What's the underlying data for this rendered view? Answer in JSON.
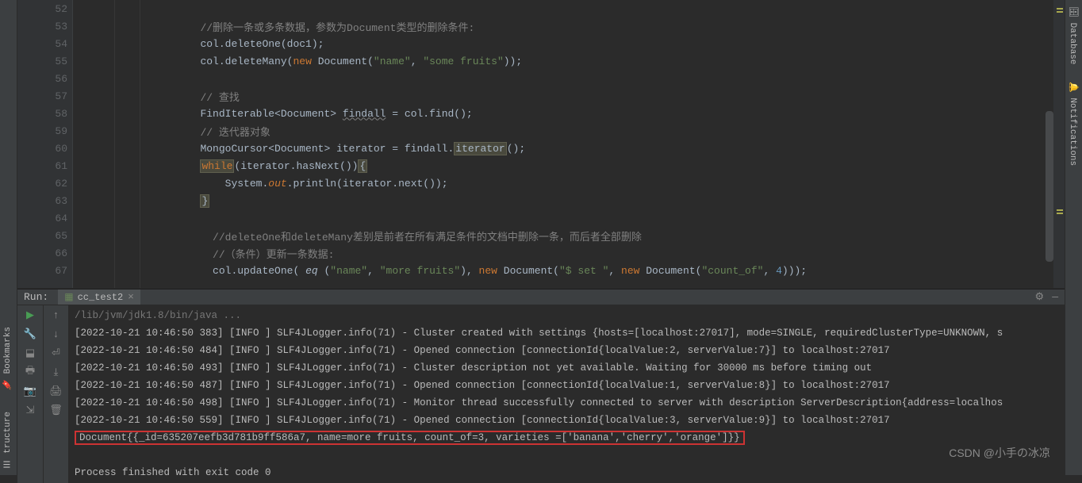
{
  "editor": {
    "lines": [
      {
        "num": 52,
        "segments": []
      },
      {
        "num": 53,
        "segments": [
          {
            "cls": "c-comment",
            "text": "//删除一条或多条数据，参数为Document类型的删除条件:"
          }
        ]
      },
      {
        "num": 54,
        "segments": [
          {
            "cls": "c-plain",
            "text": "col.deleteOne(doc1);"
          }
        ]
      },
      {
        "num": 55,
        "segments": [
          {
            "cls": "c-plain",
            "text": "col.deleteMany("
          },
          {
            "cls": "c-keyword",
            "text": "new "
          },
          {
            "cls": "c-plain",
            "text": "Document("
          },
          {
            "cls": "c-string",
            "text": "\"name\""
          },
          {
            "cls": "c-plain",
            "text": ", "
          },
          {
            "cls": "c-string",
            "text": "\"some fruits\""
          },
          {
            "cls": "c-plain",
            "text": "));"
          }
        ]
      },
      {
        "num": 56,
        "segments": []
      },
      {
        "num": 57,
        "segments": [
          {
            "cls": "c-comment",
            "text": "// 查找"
          }
        ]
      },
      {
        "num": 58,
        "segments": [
          {
            "cls": "c-plain",
            "text": "FindIterable<Document> "
          },
          {
            "cls": "underline-wave",
            "text": "findall"
          },
          {
            "cls": "c-plain",
            "text": " = col.find();"
          }
        ]
      },
      {
        "num": 59,
        "segments": [
          {
            "cls": "c-comment",
            "text": "// 迭代器对象"
          }
        ]
      },
      {
        "num": 60,
        "segments": [
          {
            "cls": "c-plain",
            "text": "MongoCursor<Document> iterator = findall."
          },
          {
            "cls": "hl-box",
            "text": "iterator"
          },
          {
            "cls": "c-plain",
            "text": "();"
          }
        ]
      },
      {
        "num": 61,
        "segments": [
          {
            "cls": "hl-box c-keyword",
            "text": "while"
          },
          {
            "cls": "c-plain",
            "text": "(iterator.hasNext())"
          },
          {
            "cls": "hl-box",
            "text": "{"
          }
        ]
      },
      {
        "num": 62,
        "segments": [
          {
            "cls": "c-plain",
            "text": "    System."
          },
          {
            "cls": "c-field",
            "text": "out"
          },
          {
            "cls": "c-plain",
            "text": ".println(iterator.next());"
          }
        ]
      },
      {
        "num": 63,
        "segments": [
          {
            "cls": "hl-box",
            "text": "}"
          }
        ]
      },
      {
        "num": 64,
        "segments": []
      },
      {
        "num": 65,
        "segments": [
          {
            "cls": "c-comment",
            "text": "//deleteOne和deleteMany差别是前者在所有满足条件的文档中删除一条，而后者全部删除"
          }
        ]
      },
      {
        "num": 66,
        "segments": [
          {
            "cls": "c-comment",
            "text": "//（条件）更新一条数据:"
          }
        ]
      },
      {
        "num": 67,
        "segments": [
          {
            "cls": "c-plain",
            "text": "col.updateOne( "
          },
          {
            "cls": "c-italic",
            "text": "eq "
          },
          {
            "cls": "c-plain",
            "text": "("
          },
          {
            "cls": "c-string",
            "text": "\"name\""
          },
          {
            "cls": "c-plain",
            "text": ", "
          },
          {
            "cls": "c-string",
            "text": "\"more fruits\""
          },
          {
            "cls": "c-plain",
            "text": "), "
          },
          {
            "cls": "c-keyword",
            "text": "new "
          },
          {
            "cls": "c-plain",
            "text": "Document("
          },
          {
            "cls": "c-string",
            "text": "\"$ set \""
          },
          {
            "cls": "c-plain",
            "text": ", "
          },
          {
            "cls": "c-keyword",
            "text": "new "
          },
          {
            "cls": "c-plain",
            "text": "Document("
          },
          {
            "cls": "c-string",
            "text": "\"count_of\""
          },
          {
            "cls": "c-plain",
            "text": ", "
          },
          {
            "cls": "c-num",
            "text": "4"
          },
          {
            "cls": "c-plain",
            "text": ")));"
          }
        ]
      }
    ]
  },
  "run": {
    "label": "Run:",
    "tab_name": "cc_test2",
    "console_lines": [
      {
        "text": "/lib/jvm/jdk1.8/bin/java ...",
        "dim": true
      },
      {
        "text": "[2022-10-21 10:46:50 383] [INFO ] SLF4JLogger.info(71) - Cluster created with settings {hosts=[localhost:27017], mode=SINGLE, requiredClusterType=UNKNOWN, s"
      },
      {
        "text": "[2022-10-21 10:46:50 484] [INFO ] SLF4JLogger.info(71) - Opened connection [connectionId{localValue:2, serverValue:7}] to localhost:27017"
      },
      {
        "text": "[2022-10-21 10:46:50 493] [INFO ] SLF4JLogger.info(71) - Cluster description not yet available. Waiting for 30000 ms before timing out"
      },
      {
        "text": "[2022-10-21 10:46:50 487] [INFO ] SLF4JLogger.info(71) - Opened connection [connectionId{localValue:1, serverValue:8}] to localhost:27017"
      },
      {
        "text": "[2022-10-21 10:46:50 498] [INFO ] SLF4JLogger.info(71) - Monitor thread successfully connected to server with description ServerDescription{address=localhos"
      },
      {
        "text": "[2022-10-21 10:46:50 559] [INFO ] SLF4JLogger.info(71) - Opened connection [connectionId{localValue:3, serverValue:9}] to localhost:27017"
      },
      {
        "text": "Document{{_id=635207eefb3d781b9ff586a7, name=more fruits, count_of=3, varieties =['banana','cherry','orange']}}",
        "boxed": true
      },
      {
        "text": ""
      },
      {
        "text": "Process finished with exit code 0"
      }
    ]
  },
  "side_tabs": {
    "database": "Database",
    "notifications": "Notifications",
    "bookmarks": "Bookmarks",
    "structure": "tructure"
  },
  "watermark": "CSDN @小手の冰凉"
}
